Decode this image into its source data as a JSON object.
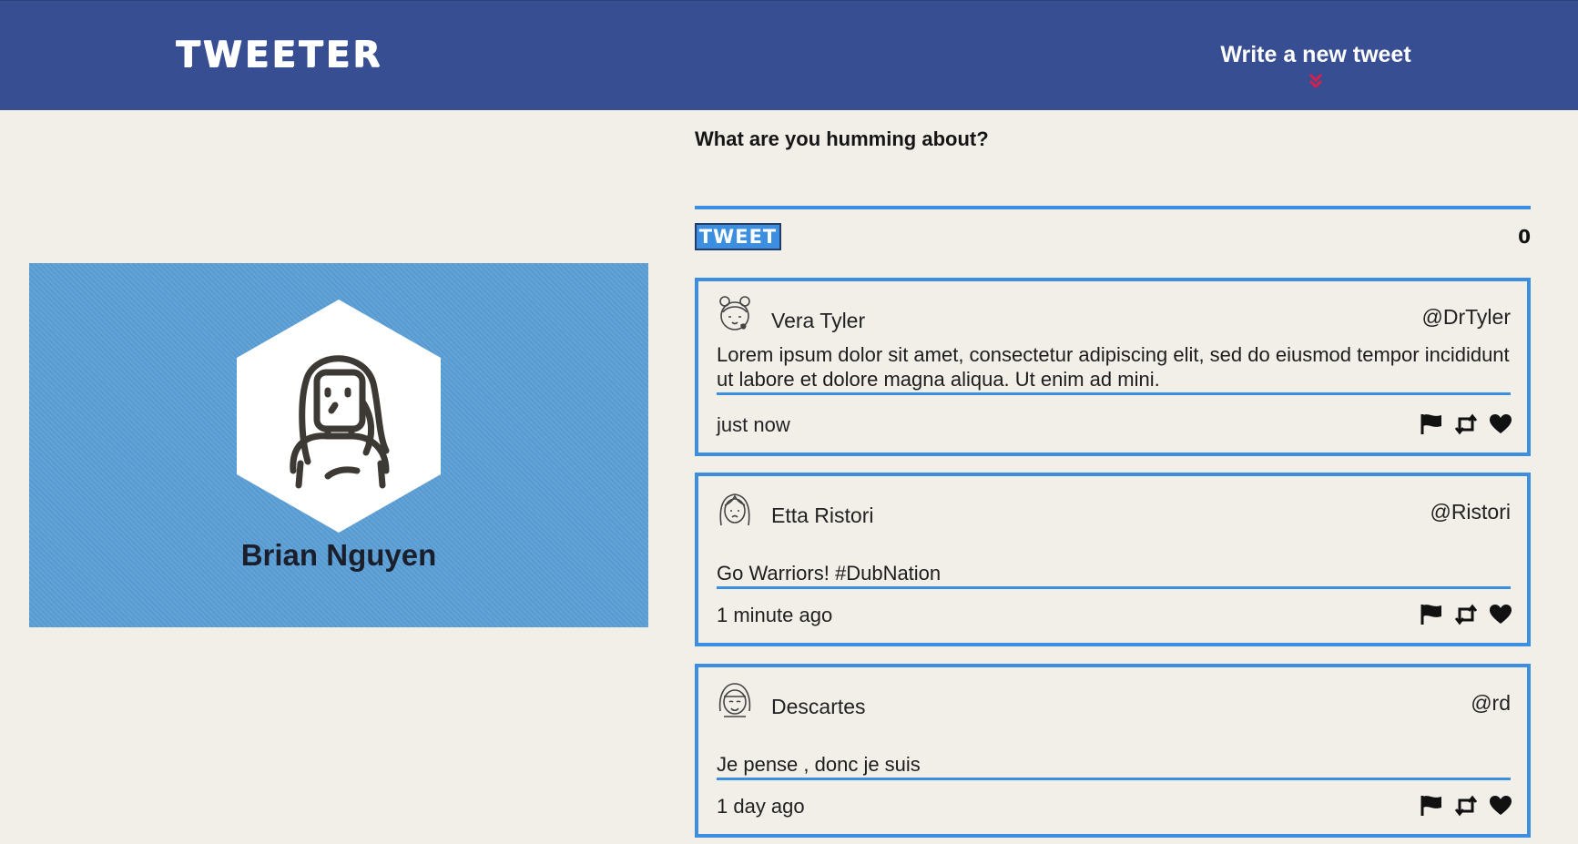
{
  "nav": {
    "brand": "TWEETER",
    "compose_label": "Write a new tweet"
  },
  "profile": {
    "name": "Brian Nguyen"
  },
  "composer": {
    "prompt": "What are you humming about?",
    "placeholder": "",
    "submit_label": "TWEET",
    "char_counter": "0"
  },
  "tweets": [
    {
      "name": "Vera Tyler",
      "handle": "@DrTyler",
      "text": "Lorem ipsum dolor sit amet, consectetur adipiscing elit, sed do eiusmod tempor incididunt ut labore et dolore magna aliqua. Ut enim ad mini.",
      "time": "just now",
      "avatar_icon": "girl-with-buns-avatar-icon"
    },
    {
      "name": "Etta Ristori",
      "handle": "@Ristori",
      "text": "Go Warriors! #DubNation",
      "time": "1 minute ago",
      "avatar_icon": "long-hair-woman-avatar-icon"
    },
    {
      "name": "Descartes",
      "handle": "@rd",
      "text": "Je pense , donc je suis",
      "time": "1 day ago",
      "avatar_icon": "smiling-bob-hair-avatar-icon"
    }
  ],
  "icons": {
    "flag": "flag-icon",
    "retweet": "retweet-icon",
    "like": "heart-icon",
    "compose_arrow": "double-chevron-down-icon"
  },
  "colors": {
    "nav_bg": "#384e92",
    "page_bg": "#f2efe9",
    "accent_blue": "#3b8ee0",
    "profile_bg": "#5b9fd6",
    "arrow_red": "#d6204b"
  }
}
